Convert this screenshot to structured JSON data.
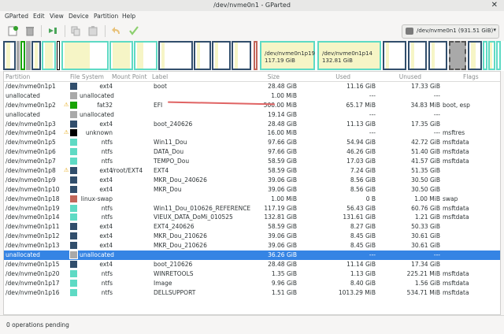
{
  "window": {
    "title": "/dev/nvme0n1 - GParted",
    "close_glyph": "✕"
  },
  "menu": [
    "GParted",
    "Edit",
    "View",
    "Device",
    "Partition",
    "Help"
  ],
  "device_selector": "/dev/nvme0n1  (931.51 GiB)",
  "diskmap_labels": {
    "p19": {
      "name": "/dev/nvme0n1p19",
      "size": "117.19 GiB"
    },
    "p14": {
      "name": "/dev/nvme0n1p14",
      "size": "132.81 GiB"
    }
  },
  "columns": [
    "Partition",
    "File System",
    "Mount Point",
    "Label",
    "Size",
    "Used",
    "Unused",
    "Flags"
  ],
  "fs_colors": {
    "ext4": "#314e6c",
    "fat32": "#18a303",
    "unallocated": "#a9a9a9",
    "unknown": "#000000",
    "ntfs": "#5edac4",
    "linux-swap": "#c1665a"
  },
  "rows": [
    {
      "partition": "/dev/nvme0n1p1",
      "fs": "ext4",
      "mount": "",
      "label": "boot",
      "size": "28.48 GiB",
      "used": "11.16 GiB",
      "unused": "17.33 GiB",
      "flags": "",
      "warn": false
    },
    {
      "partition": "unallocated",
      "fs": "unallocated",
      "mount": "",
      "label": "",
      "size": "1.00 MiB",
      "used": "---",
      "unused": "---",
      "flags": "",
      "warn": false
    },
    {
      "partition": "/dev/nvme0n1p2",
      "fs": "fat32",
      "mount": "",
      "label": "EFI",
      "size": "500.00 MiB",
      "used": "65.17 MiB",
      "unused": "34.83 MiB",
      "flags": "boot, esp",
      "warn": true
    },
    {
      "partition": "unallocated",
      "fs": "unallocated",
      "mount": "",
      "label": "",
      "size": "19.14 GiB",
      "used": "---",
      "unused": "---",
      "flags": "",
      "warn": false
    },
    {
      "partition": "/dev/nvme0n1p3",
      "fs": "ext4",
      "mount": "",
      "label": "boot_240626",
      "size": "28.48 GiB",
      "used": "11.13 GiB",
      "unused": "17.35 GiB",
      "flags": "",
      "warn": false
    },
    {
      "partition": "/dev/nvme0n1p4",
      "fs": "unknown",
      "mount": "",
      "label": "",
      "size": "16.00 MiB",
      "used": "---",
      "unused": "---",
      "flags": "msftres",
      "warn": true
    },
    {
      "partition": "/dev/nvme0n1p5",
      "fs": "ntfs",
      "mount": "",
      "label": "Win11_Dou",
      "size": "97.66 GiB",
      "used": "54.94 GiB",
      "unused": "42.72 GiB",
      "flags": "msftdata",
      "warn": false
    },
    {
      "partition": "/dev/nvme0n1p6",
      "fs": "ntfs",
      "mount": "",
      "label": "DATA_Dou",
      "size": "97.66 GiB",
      "used": "46.26 GiB",
      "unused": "51.40 GiB",
      "flags": "msftdata",
      "warn": false
    },
    {
      "partition": "/dev/nvme0n1p7",
      "fs": "ntfs",
      "mount": "",
      "label": "TEMPO_Dou",
      "size": "58.59 GiB",
      "used": "17.03 GiB",
      "unused": "41.57 GiB",
      "flags": "msftdata",
      "warn": false
    },
    {
      "partition": "/dev/nvme0n1p8",
      "fs": "ext4",
      "mount": "/root/EXT4",
      "label": "EXT4",
      "size": "58.59 GiB",
      "used": "7.24 GiB",
      "unused": "51.35 GiB",
      "flags": "",
      "warn": true
    },
    {
      "partition": "/dev/nvme0n1p9",
      "fs": "ext4",
      "mount": "",
      "label": "MKR_Dou_240626",
      "size": "39.06 GiB",
      "used": "8.56 GiB",
      "unused": "30.50 GiB",
      "flags": "",
      "warn": false
    },
    {
      "partition": "/dev/nvme0n1p10",
      "fs": "ext4",
      "mount": "",
      "label": "MKR_Dou",
      "size": "39.06 GiB",
      "used": "8.56 GiB",
      "unused": "30.50 GiB",
      "flags": "",
      "warn": false
    },
    {
      "partition": "/dev/nvme0n1p18",
      "fs": "linux-swap",
      "mount": "",
      "label": "",
      "size": "1.00 MiB",
      "used": "0 B",
      "unused": "1.00 MiB",
      "flags": "swap",
      "warn": false
    },
    {
      "partition": "/dev/nvme0n1p19",
      "fs": "ntfs",
      "mount": "",
      "label": "Win11_Dou_010626_REFERENCE",
      "size": "117.19 GiB",
      "used": "56.43 GiB",
      "unused": "60.76 GiB",
      "flags": "msftdata",
      "warn": false
    },
    {
      "partition": "/dev/nvme0n1p14",
      "fs": "ntfs",
      "mount": "",
      "label": "VIEUX_DATA_DoMi_010525",
      "size": "132.81 GiB",
      "used": "131.61 GiB",
      "unused": "1.21 GiB",
      "flags": "msftdata",
      "warn": false
    },
    {
      "partition": "/dev/nvme0n1p11",
      "fs": "ext4",
      "mount": "",
      "label": "EXT4_240626",
      "size": "58.59 GiB",
      "used": "8.27 GiB",
      "unused": "50.33 GiB",
      "flags": "",
      "warn": false
    },
    {
      "partition": "/dev/nvme0n1p12",
      "fs": "ext4",
      "mount": "",
      "label": "MKR_Dou_210626",
      "size": "39.06 GiB",
      "used": "8.45 GiB",
      "unused": "30.61 GiB",
      "flags": "",
      "warn": false
    },
    {
      "partition": "/dev/nvme0n1p13",
      "fs": "ext4",
      "mount": "",
      "label": "MKR_Dou_210626",
      "size": "39.06 GiB",
      "used": "8.45 GiB",
      "unused": "30.61 GiB",
      "flags": "",
      "warn": false
    },
    {
      "partition": "unallocated",
      "fs": "unallocated",
      "mount": "",
      "label": "",
      "size": "36.26 GiB",
      "used": "---",
      "unused": "---",
      "flags": "",
      "warn": false,
      "selected": true
    },
    {
      "partition": "/dev/nvme0n1p15",
      "fs": "ext4",
      "mount": "",
      "label": "boot_210626",
      "size": "28.48 GiB",
      "used": "11.14 GiB",
      "unused": "17.34 GiB",
      "flags": "",
      "warn": false
    },
    {
      "partition": "/dev/nvme0n1p20",
      "fs": "ntfs",
      "mount": "",
      "label": "WINRETOOLS",
      "size": "1.35 GiB",
      "used": "1.13 GiB",
      "unused": "225.21 MiB",
      "flags": "msftdata",
      "warn": false
    },
    {
      "partition": "/dev/nvme0n1p17",
      "fs": "ntfs",
      "mount": "",
      "label": "Image",
      "size": "9.96 GiB",
      "used": "8.40 GiB",
      "unused": "1.56 GiB",
      "flags": "msftdata",
      "warn": false
    },
    {
      "partition": "/dev/nvme0n1p16",
      "fs": "ntfs",
      "mount": "",
      "label": "DELLSUPPORT",
      "size": "1.51 GiB",
      "used": "1013.29 MiB",
      "unused": "534.71 MiB",
      "flags": "msftdata",
      "warn": false
    }
  ],
  "status": "0 operations pending"
}
